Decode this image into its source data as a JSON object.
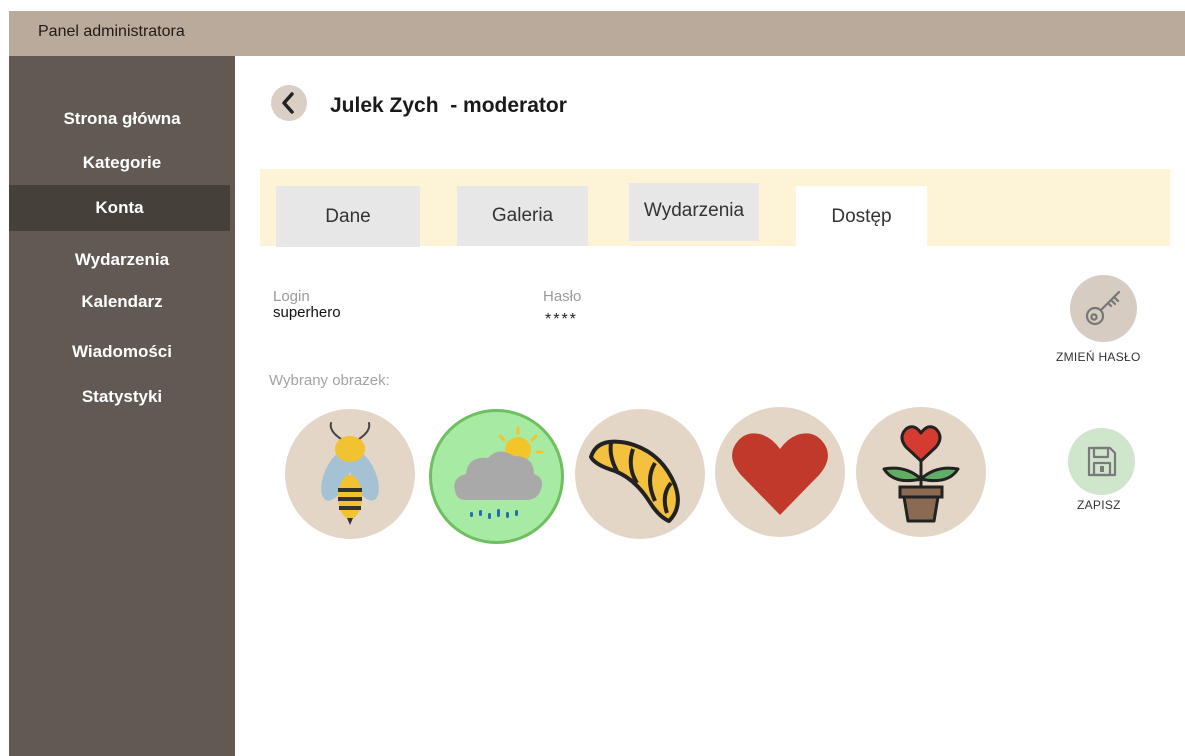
{
  "header": {
    "title": "Panel administratora"
  },
  "sidebar": {
    "items": [
      {
        "label": "Strona główna"
      },
      {
        "label": "Kategorie"
      },
      {
        "label": "Konta"
      },
      {
        "label": "Wydarzenia"
      },
      {
        "label": "Kalendarz"
      },
      {
        "label": "Wiadomości"
      },
      {
        "label": "Statystyki"
      }
    ],
    "active": "Konta"
  },
  "page": {
    "title": "Julek Zych  - moderator"
  },
  "tabs": [
    {
      "label": "Dane"
    },
    {
      "label": "Galeria"
    },
    {
      "label": "Wydarzenia"
    },
    {
      "label": "Dostęp"
    }
  ],
  "active_tab": "Dostęp",
  "account": {
    "login_label": "Login",
    "login_value": "superhero",
    "password_label": "Hasło",
    "password_value": "****"
  },
  "avatars": {
    "label": "Wybrany obrazek:",
    "items": [
      {
        "icon": "bee-icon"
      },
      {
        "icon": "rain-cloud-sun-icon",
        "selected": true
      },
      {
        "icon": "croissant-icon"
      },
      {
        "icon": "heart-icon"
      },
      {
        "icon": "heart-flower-pot-icon"
      }
    ]
  },
  "actions": {
    "change_password_label": "ZMIEŃ HASŁO",
    "save_label": "ZAPISZ"
  },
  "colors": {
    "topbar": "#b9aa9c",
    "sidebar": "#625a52",
    "sidebar_active": "#45403a",
    "tabs_band": "#fdf3d7",
    "avatar_bg": "#e3d6c7",
    "avatar_selected_bg": "#a7eaa4"
  }
}
